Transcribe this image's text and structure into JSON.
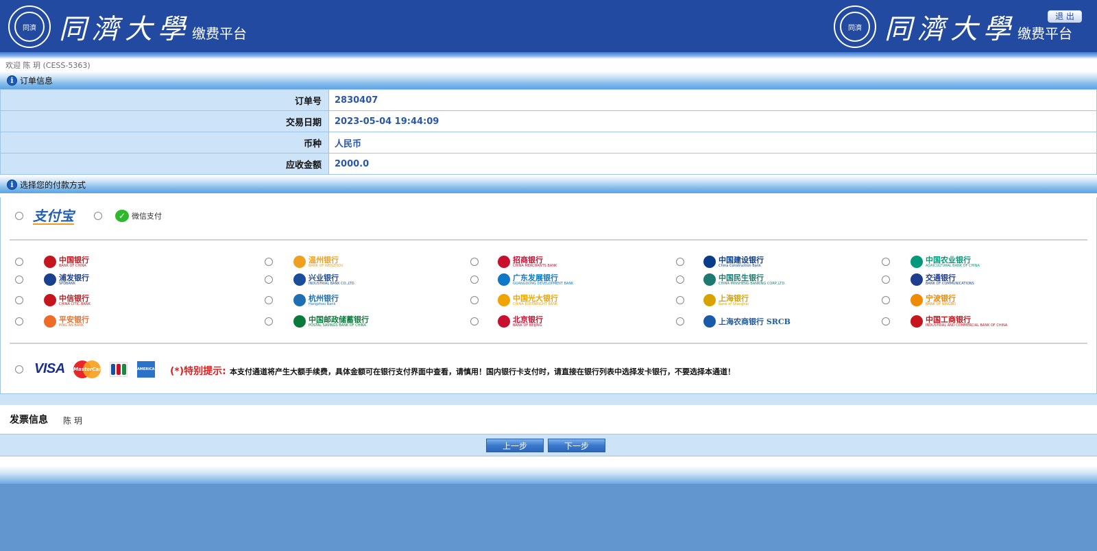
{
  "header": {
    "seal_text": "同濟",
    "brand_name": "同濟大學",
    "brand_sub": "缴费平台",
    "logout_label": "退 出"
  },
  "welcome": "欢迎 陈 玥 (CESS-5363)",
  "order_section": {
    "title": "订单信息",
    "rows": [
      {
        "label": "订单号",
        "value": "2830407"
      },
      {
        "label": "交易日期",
        "value": "2023-05-04 19:44:09"
      },
      {
        "label": "币种",
        "value": "人民币"
      },
      {
        "label": "应收金额",
        "value": "2000.0"
      }
    ]
  },
  "payment_section": {
    "title": "选择您的付款方式",
    "third_party": {
      "alipay": "支付宝",
      "wechat": "微信支付"
    },
    "banks": [
      {
        "cn": "中国银行",
        "en": "BANK OF CHINA",
        "color": "#c4161c"
      },
      {
        "cn": "温州银行",
        "en": "BANK OF WENZHOU",
        "color": "#f0a020"
      },
      {
        "cn": "招商银行",
        "en": "CHINA MERCHANTS BANK",
        "color": "#c8102e"
      },
      {
        "cn": "中国建设银行",
        "en": "China Construction Bank",
        "color": "#0a3c8c"
      },
      {
        "cn": "中国农业银行",
        "en": "AGRICULTURAL BANK OF CHINA",
        "color": "#009a7a"
      },
      {
        "cn": "浦发银行",
        "en": "SPDBANK",
        "color": "#1b3f8f"
      },
      {
        "cn": "兴业银行",
        "en": "INDUSTRIAL BANK CO.,LTD.",
        "color": "#1a4d9c"
      },
      {
        "cn": "广东发展银行",
        "en": "GUANGDONG DEVELOPMENT BANK",
        "color": "#0c78c6"
      },
      {
        "cn": "中国民生银行",
        "en": "CHINA MINSHENG BANKING CORP.,LTD.",
        "color": "#1e7a6e"
      },
      {
        "cn": "交通银行",
        "en": "BANK OF COMMUNICATIONS",
        "color": "#1f3d8f"
      },
      {
        "cn": "中信银行",
        "en": "CHINA CITIC BANK",
        "color": "#c4161c"
      },
      {
        "cn": "杭州银行",
        "en": "Hangzhou Bank",
        "color": "#1b6fb2"
      },
      {
        "cn": "中国光大银行",
        "en": "CHINA EVERBRIGHT BANK",
        "color": "#f1a300"
      },
      {
        "cn": "上海银行",
        "en": "Bank of Shanghai",
        "color": "#d8a300"
      },
      {
        "cn": "宁波银行",
        "en": "BANK OF NINGBO",
        "color": "#f08a00"
      },
      {
        "cn": "平安银行",
        "en": "PING AN BANK",
        "color": "#ef6c26"
      },
      {
        "cn": "中国邮政储蓄银行",
        "en": "POSTAL SAVINGS BANK OF CHINA",
        "color": "#0a7a3a"
      },
      {
        "cn": "北京银行",
        "en": "BANK OF BEIJING",
        "color": "#c8102e"
      },
      {
        "cn": "上海农商银行 SRCB",
        "en": "",
        "color": "#1a5aa8"
      },
      {
        "cn": "中国工商银行",
        "en": "INDUSTRIAL AND COMMERCIAL BANK OF CHINA",
        "color": "#c4161c"
      }
    ],
    "cards": {
      "visa": "VISA",
      "mastercard": "MasterCard",
      "jcb": "JCB",
      "amex": "AMERICAN EXPRESS"
    },
    "notice_title": "(*)特别提示:",
    "notice_text": "本支付通道将产生大额手续费，具体金额可在银行支付界面中查看，请慎用！国内银行卡支付时，请直接在银行列表中选择发卡银行，不要选择本通道！"
  },
  "invoice": {
    "label": "发票信息",
    "value": "陈 玥"
  },
  "buttons": {
    "prev": "上一步",
    "next": "下一步"
  },
  "colors": {
    "header_bg": "#224aa0",
    "page_bg": "#6196cf",
    "value_text": "#2a57a8",
    "notice_red": "#e02020"
  }
}
